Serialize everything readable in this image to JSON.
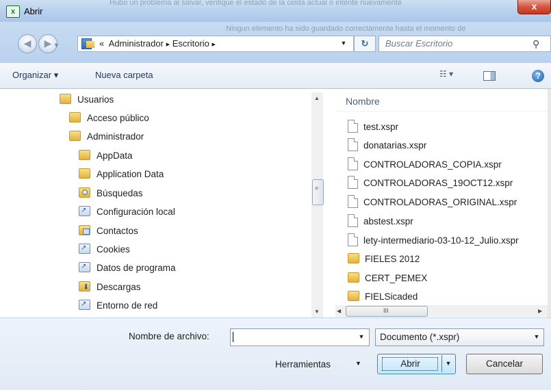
{
  "window": {
    "title": "Abrir",
    "close_label": "x"
  },
  "background_text": [
    "Hubo un problema al salvar, verifique el estado de la celda actual o intente nuevamente",
    "Ningun elemento ha sido guardado correctamente hasta el momento de"
  ],
  "address": {
    "crumbs": [
      "«",
      "Administrador",
      "▸",
      "Escritorio",
      "▸"
    ],
    "search_placeholder": "Buscar Escritorio"
  },
  "toolbar": {
    "organize": "Organizar ▾",
    "new_folder": "Nueva carpeta"
  },
  "nav_tree": [
    {
      "label": "Usuarios",
      "icon": "folder"
    },
    {
      "label": "Acceso público",
      "icon": "folder"
    },
    {
      "label": "Administrador",
      "icon": "folder"
    },
    {
      "label": "AppData",
      "icon": "folder"
    },
    {
      "label": "Application Data",
      "icon": "folder"
    },
    {
      "label": "Búsquedas",
      "icon": "search-folder"
    },
    {
      "label": "Configuración local",
      "icon": "shortcut"
    },
    {
      "label": "Contactos",
      "icon": "contacts-folder"
    },
    {
      "label": "Cookies",
      "icon": "shortcut"
    },
    {
      "label": "Datos de programa",
      "icon": "shortcut"
    },
    {
      "label": "Descargas",
      "icon": "downloads-folder"
    },
    {
      "label": "Entorno de red",
      "icon": "shortcut"
    }
  ],
  "file_list": {
    "column_header": "Nombre",
    "items": [
      {
        "label": "test.xspr",
        "icon": "file"
      },
      {
        "label": "donatarias.xspr",
        "icon": "file"
      },
      {
        "label": "CONTROLADORAS_COPIA.xspr",
        "icon": "file"
      },
      {
        "label": "CONTROLADORAS_19OCT12.xspr",
        "icon": "file"
      },
      {
        "label": "CONTROLADORAS_ORIGINAL.xspr",
        "icon": "file"
      },
      {
        "label": "abstest.xspr",
        "icon": "file"
      },
      {
        "label": "lety-intermediario-03-10-12_Julio.xspr",
        "icon": "file"
      },
      {
        "label": "FIELES 2012",
        "icon": "folder"
      },
      {
        "label": "CERT_PEMEX",
        "icon": "folder"
      },
      {
        "label": "FIELSicaded",
        "icon": "folder"
      }
    ]
  },
  "footer": {
    "filename_label": "Nombre de archivo:",
    "filename_value": "",
    "filetype_value": "Documento (*.xspr)",
    "tools_label": "Herramientas",
    "open_label": "Abrir",
    "cancel_label": "Cancelar"
  }
}
